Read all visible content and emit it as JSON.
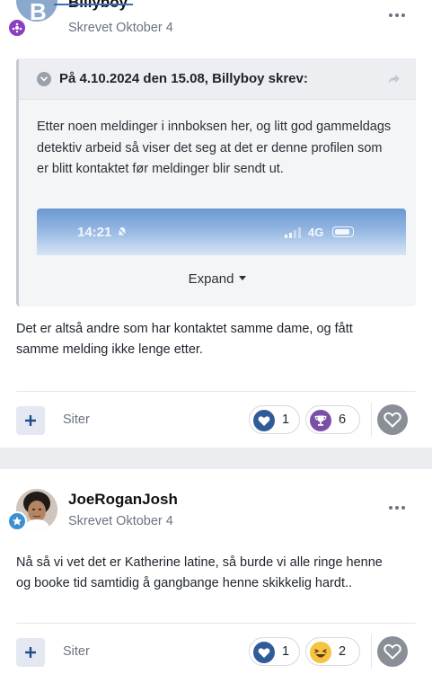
{
  "post1": {
    "author": "Billyboy",
    "meta": "Skrevet Oktober 4",
    "quote": {
      "title": "På 4.10.2024 den 15.08, Billyboy skrev:",
      "body": "Etter noen meldinger i innboksen her, og litt god gammeldags detektiv arbeid så viser det seg at det er denne profilen som er blitt kontaktet før meldinger blir sendt ut.",
      "image": {
        "time": "14:21",
        "network": "4G"
      },
      "expand_label": "Expand"
    },
    "text": "Det er altså andre som har kontaktet samme dame, og fått samme melding ikke lenge etter.",
    "footer": {
      "quote_label": "Siter",
      "reactions": [
        {
          "icon": "heart-icon",
          "count": "1"
        },
        {
          "icon": "trophy-icon",
          "count": "6"
        }
      ]
    }
  },
  "post2": {
    "author": "JoeRoganJosh",
    "meta": "Skrevet Oktober 4",
    "text": "Nå så vi vet det er Katherine latine, så burde vi alle ringe henne og booke tid samtidig å gangbange henne skikkelig hardt..",
    "footer": {
      "quote_label": "Siter",
      "reactions": [
        {
          "icon": "heart-icon",
          "count": "1"
        },
        {
          "icon": "laughing-emoji-icon",
          "count": "2"
        }
      ]
    }
  },
  "colors": {
    "accent": "#1f4d8f",
    "heart_reaction": "#2f5c99",
    "trophy_reaction": "#7a4fa8",
    "laugh_reaction": "#f6c343",
    "react_button": "#8a8f97"
  }
}
